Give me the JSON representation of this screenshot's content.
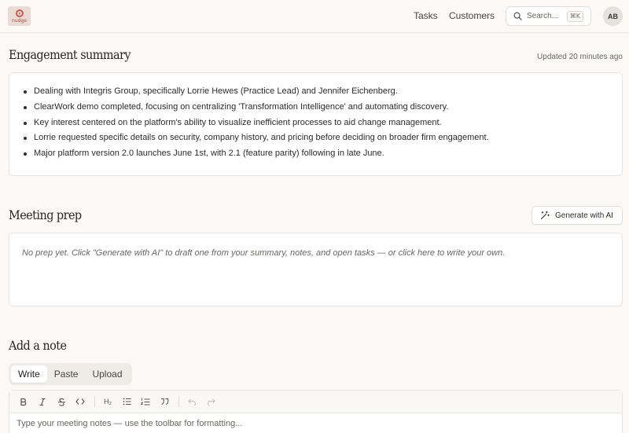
{
  "header": {
    "logo_text": "nudge",
    "nav": [
      {
        "label": "Tasks"
      },
      {
        "label": "Customers"
      }
    ],
    "search": {
      "label": "Search...",
      "shortcut": "⌘K"
    },
    "avatar_initials": "AB"
  },
  "engagement": {
    "title": "Engagement summary",
    "updated": "Updated 20 minutes ago",
    "bullets": [
      "Dealing with Integris Group, specifically Lorrie Hewes (Practice Lead) and Jennifer Eichenberg.",
      "ClearWork demo completed, focusing on centralizing 'Transformation Intelligence' and automating discovery.",
      "Key interest centered on the platform's ability to visualize inefficient processes to aid change management.",
      "Lorrie requested specific details on security, company history, and pricing before deciding on broader firm engagement.",
      "Major platform version 2.0 launches June 1st, with 2.1 (feature parity) following in late June."
    ]
  },
  "meeting_prep": {
    "title": "Meeting prep",
    "generate_label": "Generate with AI",
    "placeholder": "No prep yet. Click \"Generate with AI\" to draft one from your summary, notes, and open tasks — or click here to write your own."
  },
  "add_note": {
    "title": "Add a note",
    "tabs": [
      {
        "label": "Write",
        "active": true
      },
      {
        "label": "Paste",
        "active": false
      },
      {
        "label": "Upload",
        "active": false
      }
    ],
    "toolbar": {
      "bold": "B",
      "italic": "I",
      "heading": "H₂"
    },
    "editor_placeholder": "Type your meeting notes — use the toolbar for formatting..."
  },
  "colors": {
    "background": "#fbf8f5",
    "accent": "#d0574b",
    "card": "#ffffff"
  }
}
